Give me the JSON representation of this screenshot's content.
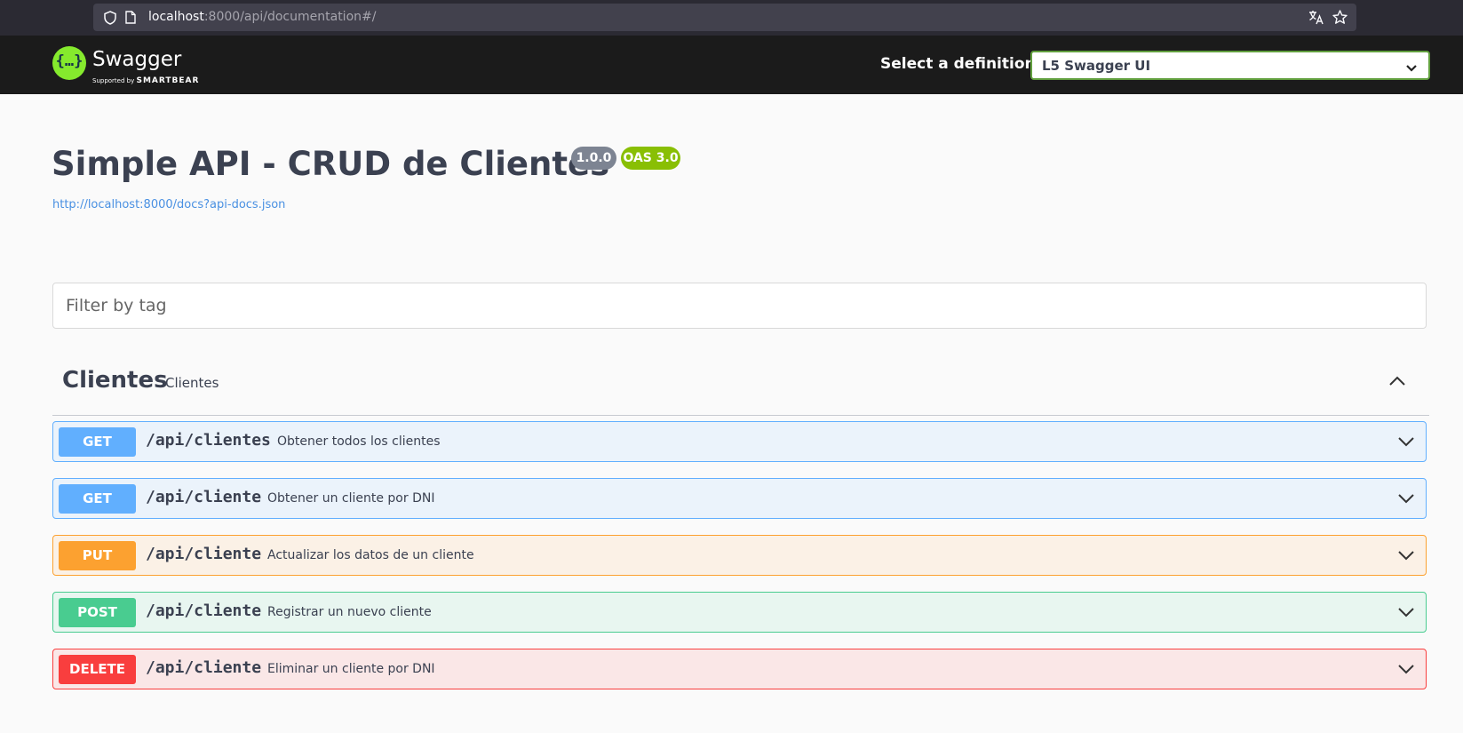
{
  "browser": {
    "url_host": "localhost",
    "url_rest": ":8000/api/documentation#/"
  },
  "header": {
    "brand": "Swagger",
    "brand_sub_prefix": "Supported by",
    "brand_sub_company": "SMARTBEAR",
    "definition_label": "Select a definition",
    "definition_selected": "L5 Swagger UI"
  },
  "info": {
    "title": "Simple API - CRUD de Clientes",
    "version": "1.0.0",
    "oas": "OAS 3.0",
    "spec_url": "http://localhost:8000/docs?api-docs.json"
  },
  "filter": {
    "placeholder": "Filter by tag"
  },
  "tag": {
    "name": "Clientes",
    "description": "Clientes"
  },
  "operations": [
    {
      "method": "GET",
      "path": "/api/clientes",
      "summary": "Obtener todos los clientes"
    },
    {
      "method": "GET",
      "path": "/api/cliente",
      "summary": "Obtener un cliente por DNI"
    },
    {
      "method": "PUT",
      "path": "/api/cliente",
      "summary": "Actualizar los datos de un cliente"
    },
    {
      "method": "POST",
      "path": "/api/cliente",
      "summary": "Registrar un nuevo cliente"
    },
    {
      "method": "DELETE",
      "path": "/api/cliente",
      "summary": "Eliminar un cliente por DNI"
    }
  ],
  "colors": {
    "get": "#61affe",
    "put": "#fca130",
    "post": "#49cc90",
    "delete": "#f93e3e",
    "brand": "#85ea2d"
  }
}
